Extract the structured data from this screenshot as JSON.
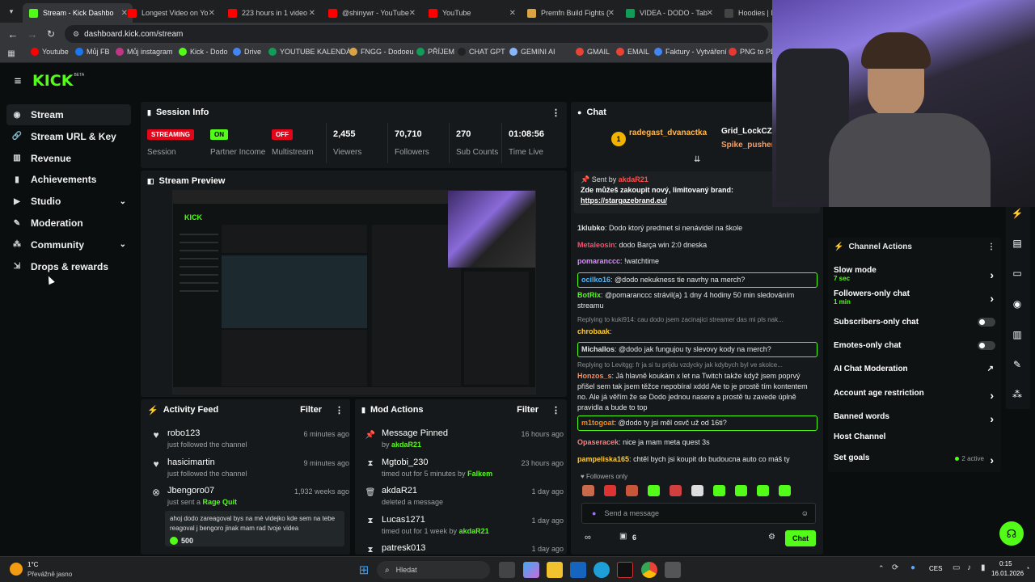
{
  "browser": {
    "tabs": [
      {
        "label": "Stream - Kick Dashbo",
        "color": "#53fc18",
        "active": true
      },
      {
        "label": "Longest Video on Yo",
        "color": "#ff0000"
      },
      {
        "label": "223 hours in 1 video",
        "color": "#ff0000"
      },
      {
        "label": "@shinywr - YouTube",
        "color": "#ff0000"
      },
      {
        "label": "YouTube",
        "color": "#ff0000"
      },
      {
        "label": "Premfn Build Fights (",
        "color": "#d9a441"
      },
      {
        "label": "VIDEA - DODO - Tab",
        "color": "#0f9d58"
      },
      {
        "label": "Hoodies | Nu",
        "color": "#444"
      }
    ],
    "url": "dashboard.kick.com/stream",
    "bookmarks": [
      "Youtube",
      "Můj FB",
      "Můj instagram",
      "Kick - Dodo",
      "Drive",
      "YOUTUBE KALENDÁŘ",
      "FNGG - Dodoeu",
      "PŘÍJEM",
      "CHAT GPT",
      "GEMINI AI",
      "GMAIL",
      "EMAIL",
      "Faktury - Vytváření",
      "PNG to PDF"
    ]
  },
  "kick": {
    "logo": "KICK",
    "logo_sup": "BETA",
    "nav": [
      {
        "label": "Stream",
        "icon": "stream-icon",
        "chev": false
      },
      {
        "label": "Stream URL & Key",
        "icon": "link-icon",
        "chev": false
      },
      {
        "label": "Revenue",
        "icon": "bank-icon",
        "chev": false
      },
      {
        "label": "Achievements",
        "icon": "trophy-icon",
        "chev": false
      },
      {
        "label": "Studio",
        "icon": "camera-icon",
        "chev": true
      },
      {
        "label": "Moderation",
        "icon": "wrench-icon",
        "chev": false
      },
      {
        "label": "Community",
        "icon": "users-icon",
        "chev": true
      },
      {
        "label": "Drops & rewards",
        "icon": "gift-icon",
        "chev": false
      }
    ],
    "session": {
      "title": "Session Info",
      "stats": [
        {
          "value": "STREAMING",
          "label": "Session",
          "pill": "#e1061a"
        },
        {
          "value": "ON",
          "label": "Partner Income",
          "pill": "#53fc18"
        },
        {
          "value": "OFF",
          "label": "Multistream",
          "pill": "#e1061a"
        },
        {
          "value": "2,455",
          "label": "Viewers"
        },
        {
          "value": "70,710",
          "label": "Followers"
        },
        {
          "value": "270",
          "label": "Sub Counts"
        },
        {
          "value": "01:08:56",
          "label": "Time Live"
        }
      ]
    },
    "preview_title": "Stream Preview",
    "activity": {
      "title": "Activity Feed",
      "filter": "Filter",
      "items": [
        {
          "name": "robo123",
          "sub": "just followed the channel",
          "time": "6 minutes ago"
        },
        {
          "name": "hasicimartin",
          "sub": "just followed the channel",
          "time": "9 minutes ago"
        },
        {
          "name": "Jbengoro07",
          "sub": "just sent a",
          "sub_hl": "Rage Quit",
          "time": "1,932 weeks ago"
        }
      ],
      "message": "ahoj dodo zareagoval bys na mé videjko kde sem na tebe reagoval j bengoro jinak mam rad tvoje videa",
      "amount": "500"
    },
    "mod": {
      "title": "Mod Actions",
      "filter": "Filter",
      "items": [
        {
          "name": "Message Pinned",
          "sub": "by",
          "by": "akdaR21",
          "time": "16 hours ago"
        },
        {
          "name": "Mgtobi_230",
          "sub": "timed out for 5 minutes by",
          "by": "Falkem",
          "time": "23 hours ago"
        },
        {
          "name": "akdaR21",
          "sub": "deleted a message",
          "by": "",
          "time": "1 day ago"
        },
        {
          "name": "Lucas1271",
          "sub": "timed out for 1 week by",
          "by": "akdaR21",
          "time": "1 day ago"
        },
        {
          "name": "patresk013",
          "sub": "",
          "by": "",
          "time": "1 day ago"
        }
      ]
    },
    "chat": {
      "title": "Chat",
      "top_users": [
        "radegast_dvanactka",
        "Grid_LockCZ",
        "Spike_pusher"
      ],
      "top_count": "1",
      "pinned_by": "Sent by",
      "pinned_user": "akdaR21",
      "pinned_text": "Zde můžeš zakoupit nový, limitovaný brand:",
      "pinned_link": "https://stargazebrand.eu/",
      "lines": [
        {
          "name": "1klubko",
          "color": "#e5e5e5",
          "text": "Dodo ktorý predmet si nenávidel na škole"
        },
        {
          "name": "Metaleosin",
          "color": "#ff4d6d",
          "text": "dodo Barça win 2:0 dneska"
        },
        {
          "name": "pomaranccc",
          "color": "#d98cff",
          "text": "!watchtime"
        },
        {
          "name": "ocilko16",
          "color": "#4db8ff",
          "text": "@dodo nekukness tie navrhy na merch?",
          "box": true
        },
        {
          "name": "BotRix",
          "color": "#53fc18",
          "text": "@pomaranccc strávil(a) 1 dny 4 hodiny 50 min sledováním streamu"
        },
        {
          "reply": "Replying to kuki914: cau dodo jsem zacinajici streamer das mi pls nak..."
        },
        {
          "name": "chrobaak",
          "color": "#ffcc33",
          "text": ""
        },
        {
          "name": "Michallos",
          "color": "#e5e5e5",
          "text": "@dodo jak fungujou ty slevovy kody na merch?",
          "box": true
        },
        {
          "reply": "Replying to Levitgg: fr ja si tu prijdu vzdycky jak kdybych byl ve skolce..."
        },
        {
          "name": "Honzos_s",
          "color": "#ff8c5a",
          "text": "Já hlavně koukám x let na Twitch takže když jsem poprvý přišel sem tak jsem těžce nepobíral xddd Ale to je prostě tím kontentem no. Ale já věřím že se Dodo jednou nasere a prostě tu zavede úplně pravidla a bude to top"
        },
        {
          "name": "m1togoat",
          "color": "#ff8c00",
          "text": "@dodo ty jsi měl osvč už od 16ti?",
          "box": true
        },
        {
          "name": "Opaseracek",
          "color": "#ff7e7e",
          "text": "nice ja mam meta quest 3s"
        },
        {
          "name": "pampeliska165",
          "color": "#ffcc33",
          "text": "chtěl bych jsi koupit do budoucna auto co máš ty"
        }
      ],
      "followers_only": "Followers only",
      "placeholder": "Send a message",
      "count": "6",
      "send": "Chat"
    },
    "actions": {
      "title": "Channel Actions",
      "items": [
        {
          "label": "Slow mode",
          "sub": "7 sec",
          "ctl": "chev"
        },
        {
          "label": "Followers-only chat",
          "sub": "1 min",
          "ctl": "chev"
        },
        {
          "label": "Subscribers-only chat",
          "ctl": "toggle"
        },
        {
          "label": "Emotes-only chat",
          "ctl": "toggle"
        },
        {
          "label": "AI Chat Moderation",
          "ctl": "ext"
        },
        {
          "label": "Account age restriction",
          "ctl": "chev"
        },
        {
          "label": "Banned words",
          "ctl": "chev"
        },
        {
          "label": "Host Channel",
          "ctl": ""
        },
        {
          "label": "Set goals",
          "ctl": "chev",
          "badge": "2 active"
        }
      ]
    }
  },
  "taskbar": {
    "weather": "1°C",
    "weather_sub": "Převážně jasno",
    "search": "Hledat",
    "lang": "CES",
    "time": "0:15",
    "date": "16.01.2026"
  }
}
